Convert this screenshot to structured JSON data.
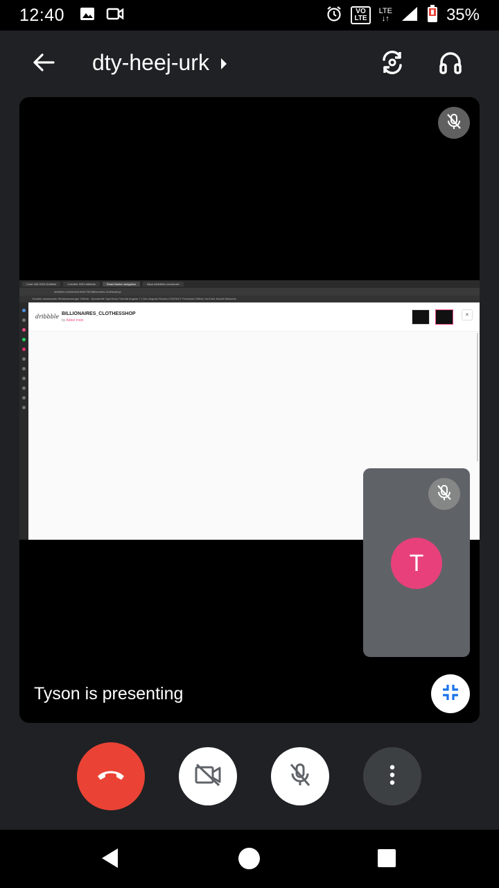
{
  "status_bar": {
    "time": "12:40",
    "volte": "VO\nLTE",
    "lte": "LTE",
    "battery_percent": "35%",
    "icons": [
      "gallery-icon",
      "video-icon",
      "alarm-icon",
      "signal-icon",
      "battery-icon"
    ]
  },
  "app_bar": {
    "meeting_code": "dty-heej-urk"
  },
  "shared_screen": {
    "tabs": [
      "Code 166 2023 Dribbble",
      "Colorfire 2023 dribbble",
      "React Native navigation",
      "https://dribbble.com/shots/"
    ],
    "url": "dribbble.com/shots/19481798-Billionaires-Clothesshop",
    "bookmarks": "Youtube downloader   Whatsmessenger   GitHub - Spoodmitt/   TypeScript Tutorial   Angular 7 | Dev   Angular Routes   CONTACT   Provincial Offices   YouTube   Kanoti Welcome",
    "shot_logo": "dribbble",
    "shot_title": "BILLIONAIRES_CLOTHESSHOP",
    "shot_by_prefix": "by",
    "shot_author": "Adeel moin",
    "close_label": "×"
  },
  "self_tile": {
    "avatar_initial": "T"
  },
  "presenting_text": "Tyson is presenting",
  "colors": {
    "end_call": "#ea4335",
    "avatar": "#e8407a",
    "accent_blue": "#1a73e8"
  }
}
